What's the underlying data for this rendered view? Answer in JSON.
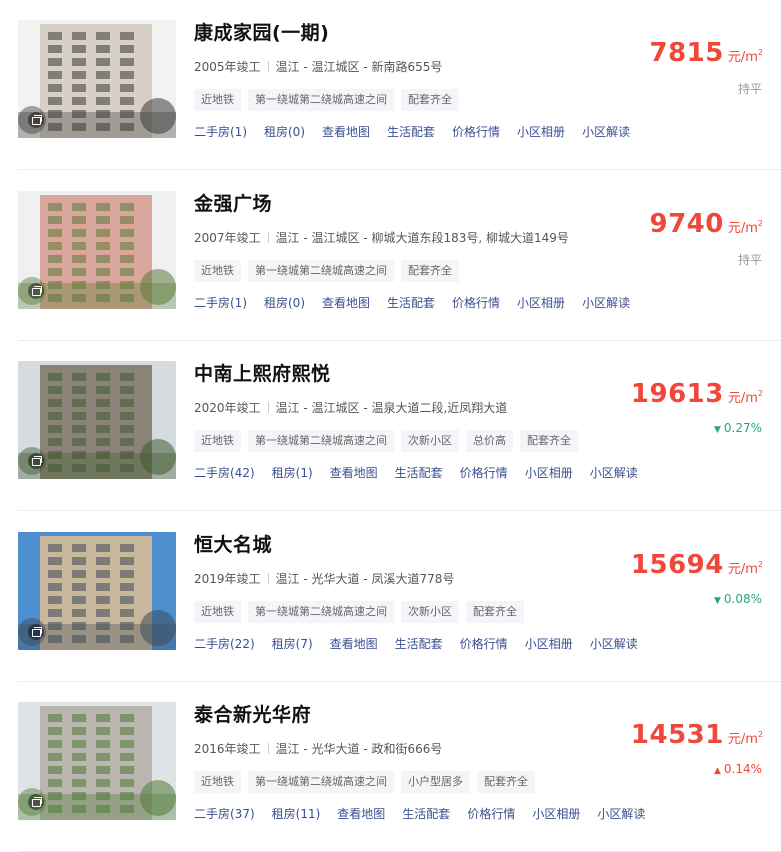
{
  "units": {
    "price_unit": "元/m",
    "price_sup": "2"
  },
  "listings": [
    {
      "name": "康成家园(一期)",
      "year": "2005年竣工",
      "location": "温江 - 温江城区 - 新南路655号",
      "tags": [
        "近地铁",
        "第一绕城第二绕城高速之间",
        "配套齐全"
      ],
      "links": [
        "二手房(1)",
        "租房(0)",
        "查看地图",
        "生活配套",
        "价格行情",
        "小区相册",
        "小区解读"
      ],
      "price": "7815",
      "trend": {
        "direction": "flat",
        "text": "持平"
      },
      "photo_palette": {
        "sky": "#f2f2f0",
        "building": "#d8d0c6",
        "accent": "#3b3a38"
      }
    },
    {
      "name": "金强广场",
      "year": "2007年竣工",
      "location": "温江 - 温江城区 - 柳城大道东段183号, 柳城大道149号",
      "tags": [
        "近地铁",
        "第一绕城第二绕城高速之间",
        "配套齐全"
      ],
      "links": [
        "二手房(1)",
        "租房(0)",
        "查看地图",
        "生活配套",
        "价格行情",
        "小区相册",
        "小区解读"
      ],
      "price": "9740",
      "trend": {
        "direction": "flat",
        "text": "持平"
      },
      "photo_palette": {
        "sky": "#eef0f2",
        "building": "#d9a79c",
        "accent": "#5b7a3a"
      }
    },
    {
      "name": "中南上熙府熙悦",
      "year": "2020年竣工",
      "location": "温江 - 温江城区 - 温泉大道二段,近凤翔大道",
      "tags": [
        "近地铁",
        "第一绕城第二绕城高速之间",
        "次新小区",
        "总价高",
        "配套齐全"
      ],
      "links": [
        "二手房(42)",
        "租房(1)",
        "查看地图",
        "生活配套",
        "价格行情",
        "小区相册",
        "小区解读"
      ],
      "price": "19613",
      "trend": {
        "direction": "down",
        "text": "0.27%"
      },
      "photo_palette": {
        "sky": "#d6dbe0",
        "building": "#8a8478",
        "accent": "#3f5a2f"
      }
    },
    {
      "name": "恒大名城",
      "year": "2019年竣工",
      "location": "温江 - 光华大道 - 凤溪大道778号",
      "tags": [
        "近地铁",
        "第一绕城第二绕城高速之间",
        "次新小区",
        "配套齐全"
      ],
      "links": [
        "二手房(22)",
        "租房(7)",
        "查看地图",
        "生活配套",
        "价格行情",
        "小区相册",
        "小区解读"
      ],
      "price": "15694",
      "trend": {
        "direction": "down",
        "text": "0.08%"
      },
      "photo_palette": {
        "sky": "#4e8fd0",
        "building": "#c9b79c",
        "accent": "#3c4a5a"
      }
    },
    {
      "name": "泰合新光华府",
      "year": "2016年竣工",
      "location": "温江 - 光华大道 - 政和街666号",
      "tags": [
        "近地铁",
        "第一绕城第二绕城高速之间",
        "小户型居多",
        "配套齐全"
      ],
      "links": [
        "二手房(37)",
        "租房(11)",
        "查看地图",
        "生活配套",
        "价格行情",
        "小区相册",
        "小区解读"
      ],
      "price": "14531",
      "trend": {
        "direction": "up",
        "text": "0.14%"
      },
      "photo_palette": {
        "sky": "#dfe3e6",
        "building": "#b9b6b0",
        "accent": "#4f7a35"
      }
    }
  ]
}
